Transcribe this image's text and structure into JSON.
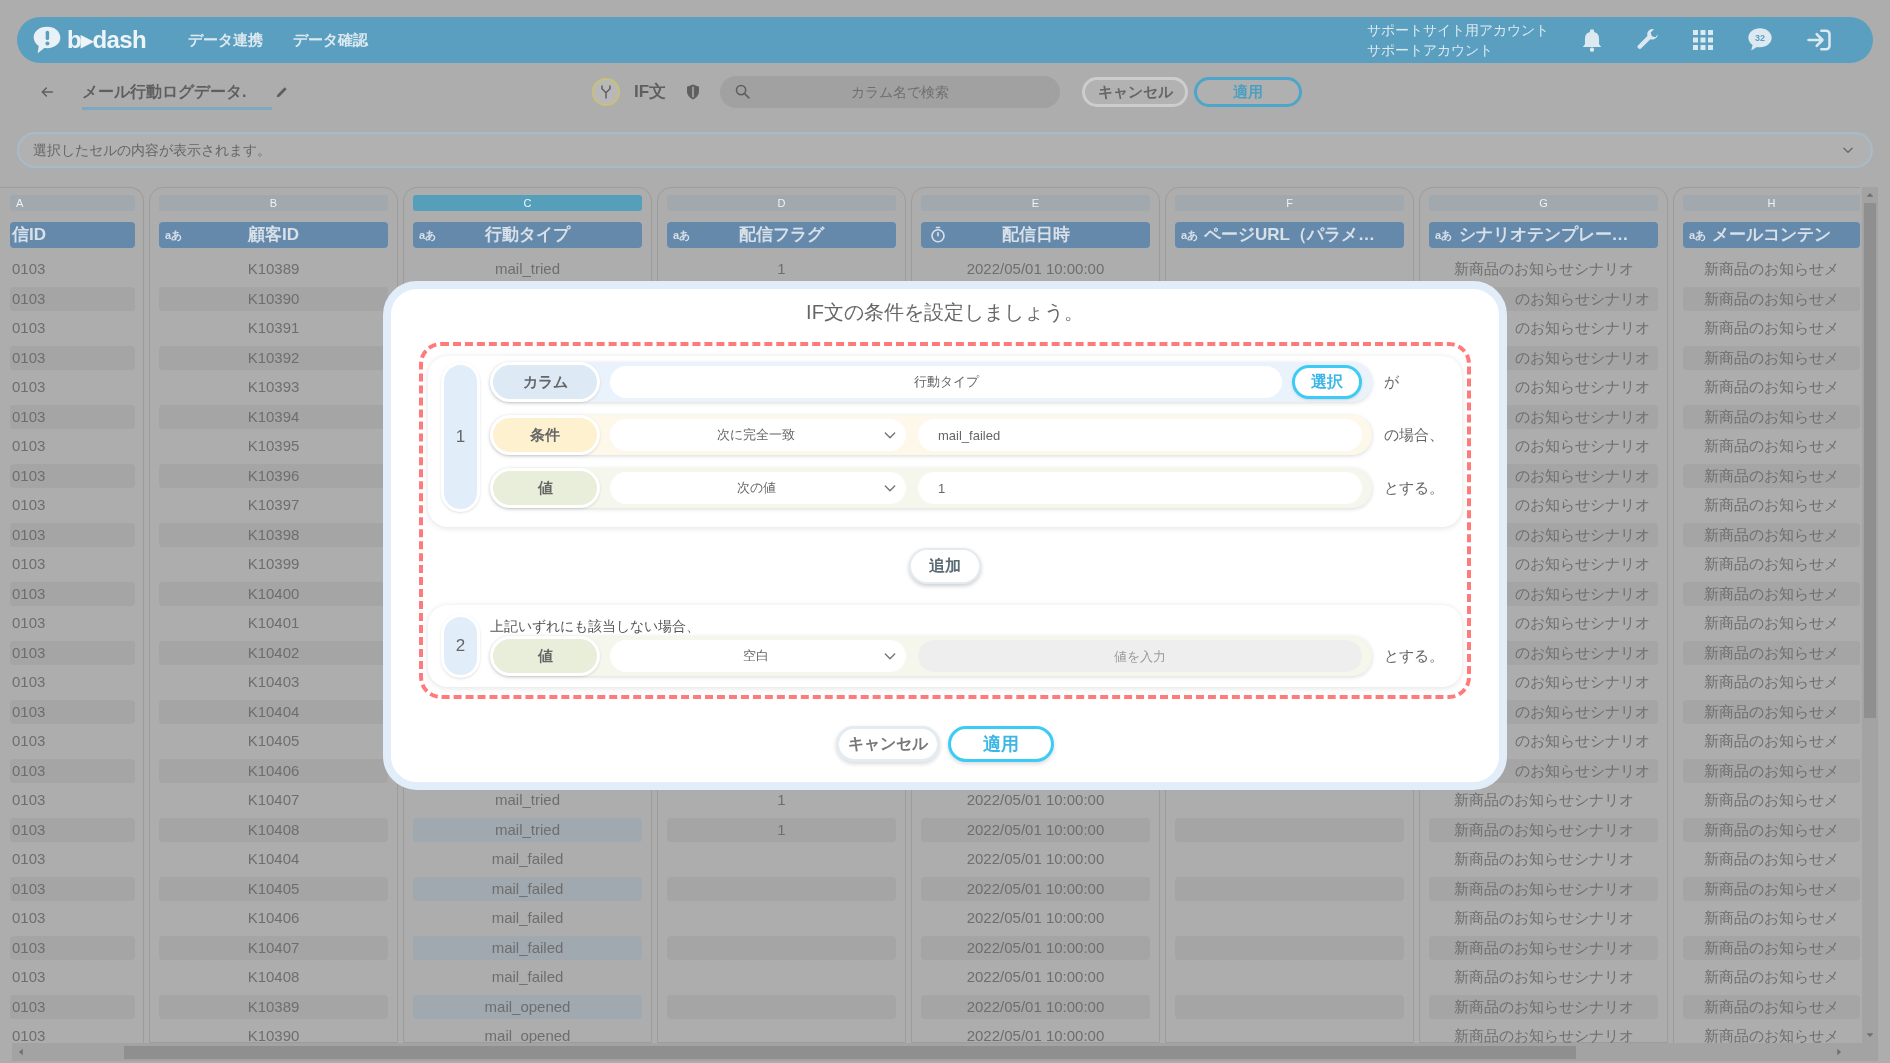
{
  "header": {
    "logo": "b▸dash",
    "nav": [
      {
        "label": "データ連携"
      },
      {
        "label": "データ確認"
      }
    ],
    "account": [
      "サポートサイト用アカウント",
      "サポートアカウント"
    ],
    "badge": "32"
  },
  "toolbar": {
    "title": "メール行動ログデータ.",
    "mode_label": "IF文",
    "search": {
      "placeholder": "カラム名で検索"
    },
    "buttons": [
      {
        "label": "キャンセル",
        "kind": "secondary"
      },
      {
        "label": "適用",
        "kind": "primary"
      }
    ]
  },
  "formula_bar": {
    "placeholder": "選択したセルの内容が表示されます。"
  },
  "grid": {
    "columns": [
      {
        "letter": "A",
        "title": "信ID",
        "selected": false
      },
      {
        "letter": "B",
        "title": "顧客ID",
        "kind": "text",
        "type_label": "aあ",
        "selected": false
      },
      {
        "letter": "C",
        "title": "行動タイプ",
        "kind": "text",
        "type_label": "aあ",
        "selected": true
      },
      {
        "letter": "D",
        "title": "配信フラグ",
        "kind": "text",
        "type_label": "aあ",
        "selected": false
      },
      {
        "letter": "E",
        "title": "配信日時",
        "kind": "datetime",
        "selected": false
      },
      {
        "letter": "F",
        "title": "ページURL（パラメ…",
        "kind": "text",
        "type_label": "aあ",
        "selected": false
      },
      {
        "letter": "G",
        "title": "シナリオテンプレー…",
        "kind": "text",
        "type_label": "aあ",
        "selected": false
      },
      {
        "letter": "H",
        "title": "メールコンテン",
        "kind": "text",
        "type_label": "aあ",
        "selected": false
      }
    ],
    "rows": [
      {
        "cells": [
          "0103",
          "K10389",
          "mail_tried",
          "1",
          "2022/05/01 10:00:00",
          null,
          "新商品のお知らせシナリオ",
          "新商品のお知らせメ"
        ]
      },
      {
        "under_dialog": true,
        "cells": [
          "0103",
          "K10390",
          null,
          null,
          null,
          null,
          "のお知らせシナリオ",
          "新商品のお知らせメ"
        ]
      },
      {
        "under_dialog": true,
        "cells": [
          "0103",
          "K10391",
          null,
          null,
          null,
          null,
          "のお知らせシナリオ",
          "新商品のお知らせメ"
        ]
      },
      {
        "under_dialog": true,
        "cells": [
          "0103",
          "K10392",
          null,
          null,
          null,
          null,
          "のお知らせシナリオ",
          "新商品のお知らせメ"
        ]
      },
      {
        "under_dialog": true,
        "cells": [
          "0103",
          "K10393",
          null,
          null,
          null,
          null,
          "のお知らせシナリオ",
          "新商品のお知らせメ"
        ]
      },
      {
        "under_dialog": true,
        "cells": [
          "0103",
          "K10394",
          null,
          null,
          null,
          null,
          "のお知らせシナリオ",
          "新商品のお知らせメ"
        ]
      },
      {
        "under_dialog": true,
        "cells": [
          "0103",
          "K10395",
          null,
          null,
          null,
          null,
          "のお知らせシナリオ",
          "新商品のお知らせメ"
        ]
      },
      {
        "under_dialog": true,
        "cells": [
          "0103",
          "K10396",
          null,
          null,
          null,
          null,
          "のお知らせシナリオ",
          "新商品のお知らせメ"
        ]
      },
      {
        "under_dialog": true,
        "cells": [
          "0103",
          "K10397",
          null,
          null,
          null,
          null,
          "のお知らせシナリオ",
          "新商品のお知らせメ"
        ]
      },
      {
        "under_dialog": true,
        "cells": [
          "0103",
          "K10398",
          null,
          null,
          null,
          null,
          "のお知らせシナリオ",
          "新商品のお知らせメ"
        ]
      },
      {
        "under_dialog": true,
        "cells": [
          "0103",
          "K10399",
          null,
          null,
          null,
          null,
          "のお知らせシナリオ",
          "新商品のお知らせメ"
        ]
      },
      {
        "under_dialog": true,
        "cells": [
          "0103",
          "K10400",
          null,
          null,
          null,
          null,
          "のお知らせシナリオ",
          "新商品のお知らせメ"
        ]
      },
      {
        "under_dialog": true,
        "cells": [
          "0103",
          "K10401",
          null,
          null,
          null,
          null,
          "のお知らせシナリオ",
          "新商品のお知らせメ"
        ]
      },
      {
        "under_dialog": true,
        "cells": [
          "0103",
          "K10402",
          null,
          null,
          null,
          null,
          "のお知らせシナリオ",
          "新商品のお知らせメ"
        ]
      },
      {
        "under_dialog": true,
        "cells": [
          "0103",
          "K10403",
          null,
          null,
          null,
          null,
          "のお知らせシナリオ",
          "新商品のお知らせメ"
        ]
      },
      {
        "under_dialog": true,
        "cells": [
          "0103",
          "K10404",
          null,
          null,
          null,
          null,
          "のお知らせシナリオ",
          "新商品のお知らせメ"
        ]
      },
      {
        "under_dialog": true,
        "cells": [
          "0103",
          "K10405",
          null,
          null,
          null,
          null,
          "のお知らせシナリオ",
          "新商品のお知らせメ"
        ]
      },
      {
        "under_dialog": true,
        "cells": [
          "0103",
          "K10406",
          null,
          null,
          null,
          null,
          "のお知らせシナリオ",
          "新商品のお知らせメ"
        ]
      },
      {
        "cells": [
          "0103",
          "K10407",
          "mail_tried",
          "1",
          "2022/05/01 10:00:00",
          null,
          "新商品のお知らせシナリオ",
          "新商品のお知らせメ"
        ]
      },
      {
        "cells": [
          "0103",
          "K10408",
          "mail_tried",
          "1",
          "2022/05/01 10:00:00",
          null,
          "新商品のお知らせシナリオ",
          "新商品のお知らせメ"
        ]
      },
      {
        "cells": [
          "0103",
          "K10404",
          "mail_failed",
          null,
          "2022/05/01 10:00:00",
          null,
          "新商品のお知らせシナリオ",
          "新商品のお知らせメ"
        ]
      },
      {
        "cells": [
          "0103",
          "K10405",
          "mail_failed",
          null,
          "2022/05/01 10:00:00",
          null,
          "新商品のお知らせシナリオ",
          "新商品のお知らせメ"
        ]
      },
      {
        "cells": [
          "0103",
          "K10406",
          "mail_failed",
          null,
          "2022/05/01 10:00:00",
          null,
          "新商品のお知らせシナリオ",
          "新商品のお知らせメ"
        ]
      },
      {
        "cells": [
          "0103",
          "K10407",
          "mail_failed",
          null,
          "2022/05/01 10:00:00",
          null,
          "新商品のお知らせシナリオ",
          "新商品のお知らせメ"
        ]
      },
      {
        "cells": [
          "0103",
          "K10408",
          "mail_failed",
          null,
          "2022/05/01 10:00:00",
          null,
          "新商品のお知らせシナリオ",
          "新商品のお知らせメ"
        ]
      },
      {
        "cells": [
          "0103",
          "K10389",
          "mail_opened",
          null,
          "2022/05/01 10:00:00",
          null,
          "新商品のお知らせシナリオ",
          "新商品のお知らせメ"
        ]
      },
      {
        "cells": [
          "0103",
          "K10390",
          "mail_opened",
          null,
          "2022/05/01 10:00:00",
          null,
          "新商品のお知らせシナリオ",
          "新商品のお知らせメ"
        ]
      }
    ]
  },
  "dialog": {
    "title": "IF文の条件を設定しましょう。",
    "conditions": [
      {
        "number": "1",
        "rows": [
          {
            "kind": "column",
            "label": "カラム",
            "field": "行動タイプ",
            "button": "選択",
            "suffix": "が"
          },
          {
            "kind": "condition",
            "label": "条件",
            "select": "次に完全一致",
            "value": "mail_failed",
            "disabled": false,
            "suffix": "の場合、"
          },
          {
            "kind": "value",
            "label": "値",
            "select": "次の値",
            "value": "1",
            "disabled": false,
            "suffix": "とする。"
          }
        ]
      }
    ],
    "add_button": "追加",
    "fallback": {
      "number": "2",
      "caption": "上記いずれにも該当しない場合、",
      "rows": [
        {
          "kind": "value",
          "label": "値",
          "select": "空白",
          "placeholder": "値を入力",
          "disabled": true,
          "suffix": "とする。"
        }
      ]
    },
    "buttons": [
      {
        "label": "キャンセル",
        "kind": "secondary"
      },
      {
        "label": "適用",
        "kind": "primary"
      }
    ]
  }
}
